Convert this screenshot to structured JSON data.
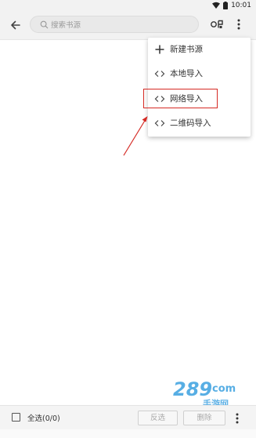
{
  "status_bar": {
    "time": "10:01"
  },
  "toolbar": {
    "search_placeholder": "搜索书源"
  },
  "menu": {
    "items": [
      {
        "label": "新建书源",
        "icon": "plus-icon"
      },
      {
        "label": "本地导入",
        "icon": "code-brackets-icon"
      },
      {
        "label": "网络导入",
        "icon": "code-brackets-icon"
      },
      {
        "label": "二维码导入",
        "icon": "code-brackets-icon"
      }
    ]
  },
  "bottom_bar": {
    "select_all_label": "全选(0/0)",
    "invert_label": "反选",
    "delete_label": "删除"
  },
  "watermark": {
    "text": "289",
    "suffix": "com",
    "sub": "手游网"
  },
  "colors": {
    "highlight": "#d52a24",
    "toolbar_bg": "#f2f2f2",
    "watermark": "#3aa0e0"
  }
}
